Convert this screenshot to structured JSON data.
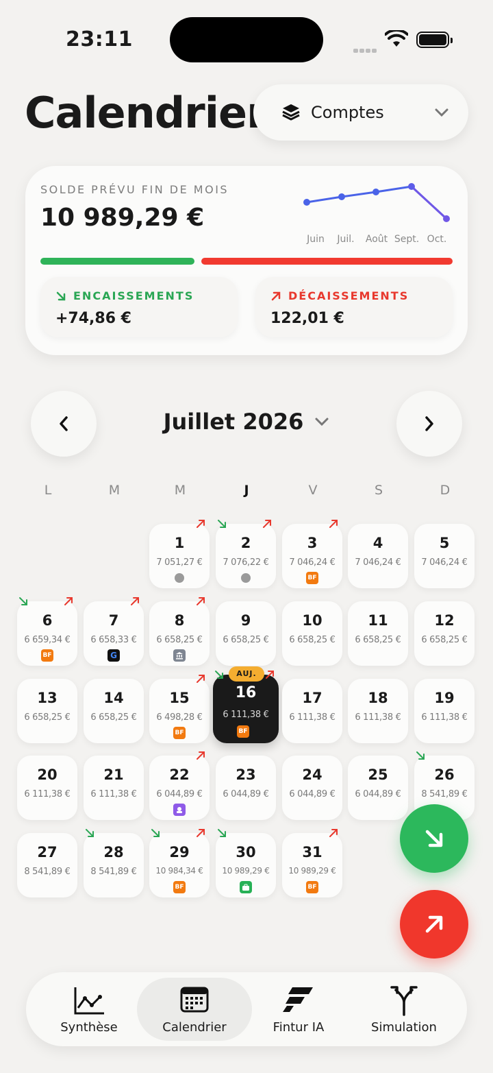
{
  "status": {
    "time": "23:11"
  },
  "header": {
    "title": "Calendrier",
    "accounts_label": "Comptes"
  },
  "summary": {
    "caption": "SOLDE PRÉVU FIN DE MOIS",
    "balance": "10 989,29 €",
    "trend_months": [
      "Juin",
      "Juil.",
      "Août",
      "Sept.",
      "Oct."
    ],
    "income_label": "ENCAISSEMENTS",
    "income_value": "+74,86 €",
    "expense_label": "DÉCAISSEMENTS",
    "expense_value": "122,01 €",
    "colors": {
      "income": "#2fb359",
      "expense": "#f13a30",
      "trend": "#4a63e8"
    }
  },
  "calendar": {
    "month_label": "Juillet 2026",
    "weekdays": [
      "L",
      "M",
      "M",
      "J",
      "V",
      "S",
      "D"
    ],
    "today_tag": "AUJ.",
    "days": [
      {
        "n": "1",
        "v": "7 051,27 €",
        "mark": "dot",
        "out": true
      },
      {
        "n": "2",
        "v": "7 076,22 €",
        "mark": "dot",
        "in": true,
        "out": true
      },
      {
        "n": "3",
        "v": "7 046,24 €",
        "mark": "bf",
        "out": true
      },
      {
        "n": "4",
        "v": "7 046,24 €"
      },
      {
        "n": "5",
        "v": "7 046,24 €"
      },
      {
        "n": "6",
        "v": "6 659,34 €",
        "mark": "bf",
        "in": true,
        "out": true
      },
      {
        "n": "7",
        "v": "6 658,33 €",
        "mark": "google",
        "out": true
      },
      {
        "n": "8",
        "v": "6 658,25 €",
        "mark": "bank",
        "out": true
      },
      {
        "n": "9",
        "v": "6 658,25 €"
      },
      {
        "n": "10",
        "v": "6 658,25 €"
      },
      {
        "n": "11",
        "v": "6 658,25 €"
      },
      {
        "n": "12",
        "v": "6 658,25 €"
      },
      {
        "n": "13",
        "v": "6 658,25 €"
      },
      {
        "n": "14",
        "v": "6 658,25 €"
      },
      {
        "n": "15",
        "v": "6 498,28 €",
        "mark": "bf",
        "out": true
      },
      {
        "n": "16",
        "v": "6 111,38 €",
        "mark": "bf",
        "in": true,
        "out": true,
        "today": true
      },
      {
        "n": "17",
        "v": "6 111,38 €"
      },
      {
        "n": "18",
        "v": "6 111,38 €"
      },
      {
        "n": "19",
        "v": "6 111,38 €"
      },
      {
        "n": "20",
        "v": "6 111,38 €"
      },
      {
        "n": "21",
        "v": "6 111,38 €"
      },
      {
        "n": "22",
        "v": "6 044,89 €",
        "mark": "purple",
        "out": true
      },
      {
        "n": "23",
        "v": "6 044,89 €"
      },
      {
        "n": "24",
        "v": "6 044,89 €"
      },
      {
        "n": "25",
        "v": "6 044,89 €"
      },
      {
        "n": "26",
        "v": "8 541,89 €",
        "in": true
      },
      {
        "n": "27",
        "v": "8 541,89 €"
      },
      {
        "n": "28",
        "v": "8 541,89 €",
        "in": true
      },
      {
        "n": "29",
        "v": "10 984,34 €",
        "mark": "bf",
        "in": true,
        "out": true
      },
      {
        "n": "30",
        "v": "10 989,29 €",
        "mark": "green",
        "in": true
      },
      {
        "n": "31",
        "v": "10 989,29 €",
        "mark": "bf",
        "out": true
      }
    ]
  },
  "tabs": [
    {
      "label": "Synthèse",
      "icon": "chart-line-icon"
    },
    {
      "label": "Calendrier",
      "icon": "calendar-icon",
      "selected": true
    },
    {
      "label": "Fintur IA",
      "icon": "fintur-logo-icon"
    },
    {
      "label": "Simulation",
      "icon": "fork-arrows-icon"
    }
  ],
  "badges": {
    "bf": "BF",
    "google": "G"
  }
}
